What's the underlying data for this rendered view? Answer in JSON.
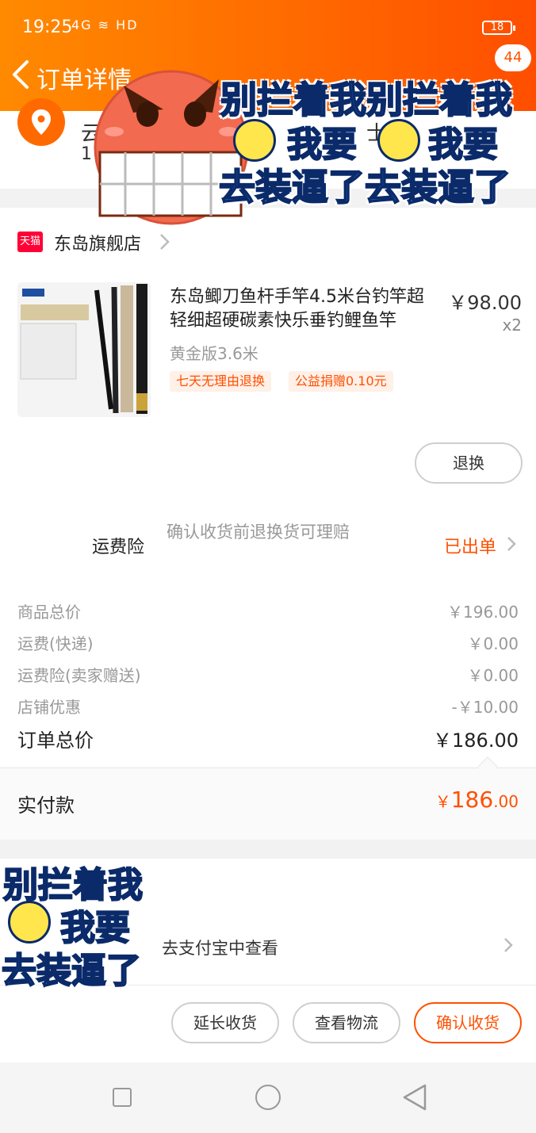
{
  "status_bar": {
    "time": "19:25",
    "network": "4G",
    "wifi": "HD",
    "battery": "18"
  },
  "header": {
    "title": "订单详情",
    "message_count": "44"
  },
  "address": {
    "line1": "云",
    "line2": "1",
    "extra": "士"
  },
  "shop": {
    "platform_badge": "天猫",
    "name": "东岛旗舰店"
  },
  "product": {
    "title": "东岛鲫刀鱼杆手竿4.5米台钓竿超轻细超硬碳素快乐垂钓鲤鱼竿",
    "price": "￥98.00",
    "quantity": "x2",
    "variant": "黄金版3.6米",
    "tags": [
      "七天无理由退换",
      "公益捐赠0.10元"
    ],
    "refund_button": "退换"
  },
  "insurance": {
    "label": "运费险",
    "description": "确认收货前退换货可理赔",
    "status": "已出单"
  },
  "summary": {
    "rows": [
      {
        "label": "商品总价",
        "value": "￥196.00"
      },
      {
        "label": "运费(快递)",
        "value": "￥0.00"
      },
      {
        "label": "运费险(卖家赠送)",
        "value": "￥0.00"
      },
      {
        "label": "店铺优惠",
        "value": "-￥10.00"
      }
    ],
    "total_label": "订单总价",
    "total_value": "￥186.00"
  },
  "paid": {
    "label": "实付款",
    "currency": "￥",
    "integer": "186",
    "decimal": ".00"
  },
  "alipay": {
    "text": "去支付宝中查看"
  },
  "actions": {
    "extend": "延长收货",
    "logistics": "查看物流",
    "confirm": "确认收货"
  },
  "meme": {
    "top_line1": "别拦着我别拦着我",
    "top_line2a": "我要",
    "top_line2b": "我要",
    "top_line3": "去装逼了去装逼了",
    "bottom_line1": "别拦着我",
    "bottom_line2": "我要",
    "bottom_line3": "去装逼了"
  },
  "colors": {
    "accent": "#ff5000",
    "header_start": "#ff8a00",
    "header_end": "#ff4e00",
    "tmall": "#ff0036"
  }
}
